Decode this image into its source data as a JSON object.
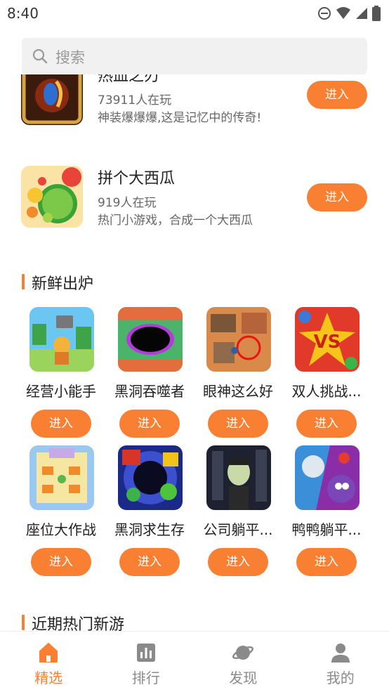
{
  "status_bar": {
    "time": "8:40"
  },
  "search": {
    "placeholder": "搜索"
  },
  "featured_games": [
    {
      "title": "热血之刃",
      "players": "73911人在玩",
      "desc": "神装爆爆爆,这是记忆中的传奇!",
      "button": "进入"
    },
    {
      "title": "拼个大西瓜",
      "players": "919人在玩",
      "desc": "热门小游戏，合成一个大西瓜",
      "button": "进入"
    }
  ],
  "section_new": {
    "title": "新鲜出炉",
    "items": [
      {
        "name": "经营小能手",
        "button": "进入"
      },
      {
        "name": "黑洞吞噬者",
        "button": "进入"
      },
      {
        "name": "眼神这么好",
        "button": "进入"
      },
      {
        "name": "双人挑战...",
        "button": "进入"
      },
      {
        "name": "座位大作战",
        "button": "进入"
      },
      {
        "name": "黑洞求生存",
        "button": "进入"
      },
      {
        "name": "公司躺平...",
        "button": "进入"
      },
      {
        "name": "鸭鸭躺平...",
        "button": "进入"
      }
    ]
  },
  "section_hot": {
    "title": "近期热门新游"
  },
  "tabs": [
    {
      "label": "精选",
      "icon": "home-icon",
      "active": true
    },
    {
      "label": "排行",
      "icon": "chart-icon",
      "active": false
    },
    {
      "label": "发现",
      "icon": "planet-icon",
      "active": false
    },
    {
      "label": "我的",
      "icon": "user-icon",
      "active": false
    }
  ],
  "colors": {
    "accent": "#f98033",
    "search_bg": "#f1f1f1",
    "text_secondary": "#666666"
  }
}
